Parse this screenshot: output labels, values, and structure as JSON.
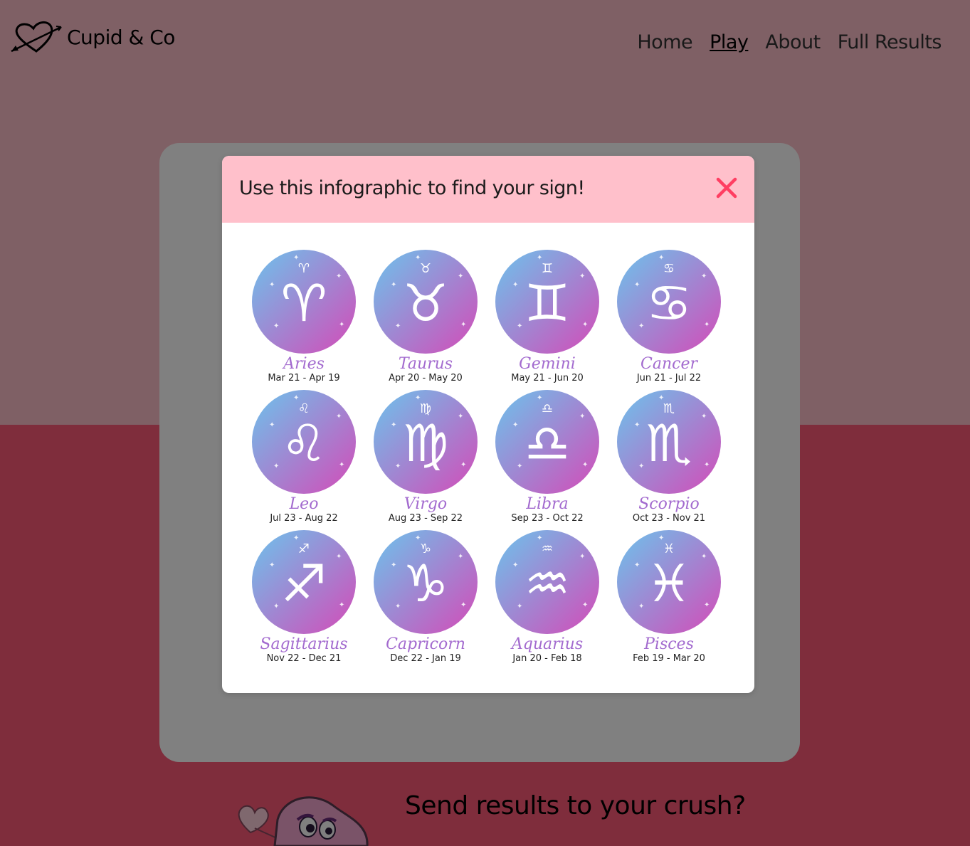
{
  "nav": {
    "brand": "Cupid & Co",
    "links": [
      "Home",
      "Play",
      "About",
      "Full Results"
    ],
    "active": "Play"
  },
  "page": {
    "crush_heading": "Send results to your crush?"
  },
  "modal": {
    "title": "Use this infographic to find your sign!",
    "signs": [
      {
        "name": "Aries",
        "dates": "Mar 21 - Apr 19",
        "glyph": "♈"
      },
      {
        "name": "Taurus",
        "dates": "Apr 20 - May 20",
        "glyph": "♉"
      },
      {
        "name": "Gemini",
        "dates": "May 21 - Jun 20",
        "glyph": "♊"
      },
      {
        "name": "Cancer",
        "dates": "Jun 21 - Jul 22",
        "glyph": "♋"
      },
      {
        "name": "Leo",
        "dates": "Jul 23 - Aug 22",
        "glyph": "♌"
      },
      {
        "name": "Virgo",
        "dates": "Aug 23 - Sep 22",
        "glyph": "♍"
      },
      {
        "name": "Libra",
        "dates": "Sep 23 - Oct 22",
        "glyph": "♎"
      },
      {
        "name": "Scorpio",
        "dates": "Oct 23 - Nov 21",
        "glyph": "♏"
      },
      {
        "name": "Sagittarius",
        "dates": "Nov 22 - Dec 21",
        "glyph": "♐"
      },
      {
        "name": "Capricorn",
        "dates": "Dec 22 - Jan 19",
        "glyph": "♑"
      },
      {
        "name": "Aquarius",
        "dates": "Jan 20 - Feb 18",
        "glyph": "♒"
      },
      {
        "name": "Pisces",
        "dates": "Feb 19 - Mar 20",
        "glyph": "♓"
      }
    ]
  },
  "colors": {
    "header_pink": "#ffc0cb",
    "lower_pink": "#ff5a79",
    "close_red": "#ff3e62",
    "sign_name_purple": "#a36bcf",
    "gradient_blue": "#6cc3ec",
    "gradient_magenta": "#d44bb8"
  },
  "icons": {
    "brand": "heart-arrow-icon",
    "close": "close-icon"
  }
}
